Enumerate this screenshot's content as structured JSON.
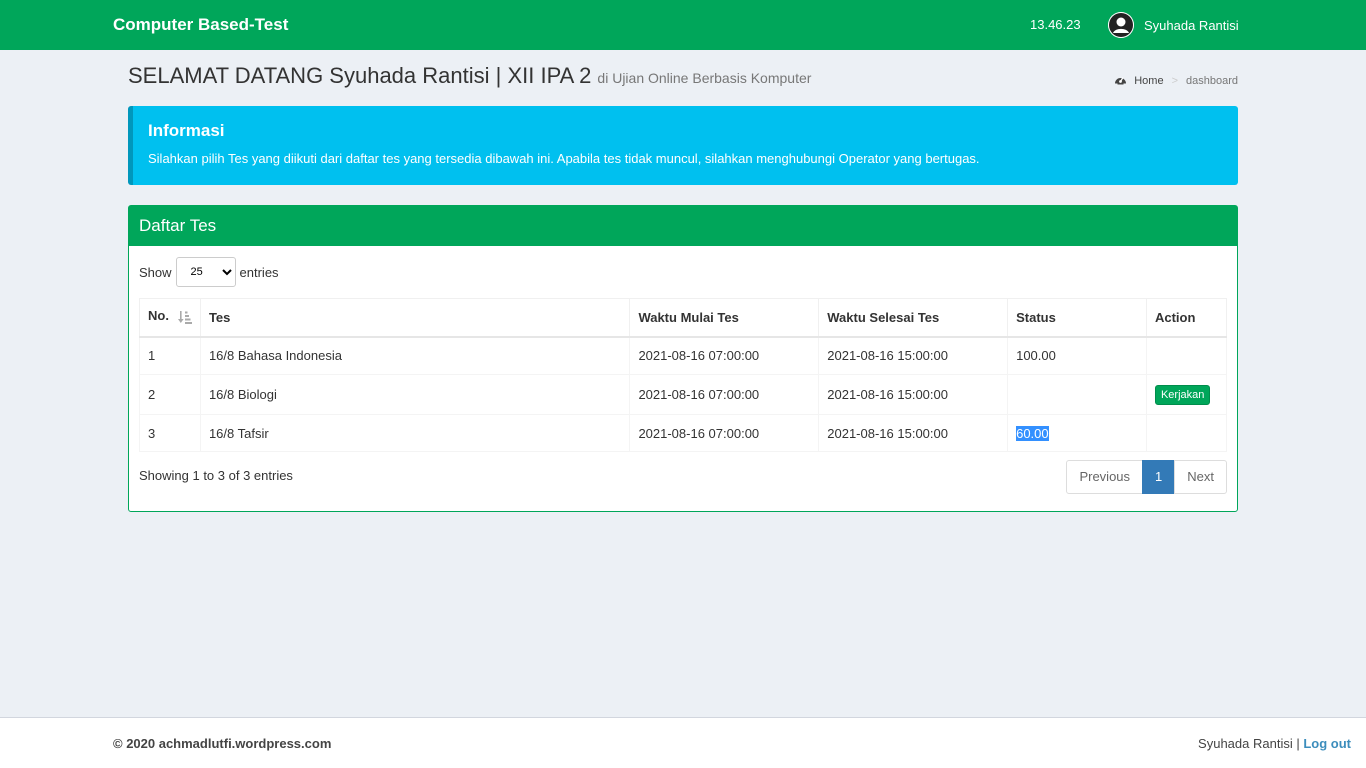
{
  "header": {
    "brand": "Computer Based-Test",
    "time": "13.46.23",
    "user_name": "Syuhada Rantisi"
  },
  "page": {
    "title": "SELAMAT DATANG Syuhada Rantisi | XII IPA 2",
    "subtitle": "di Ujian Online Berbasis Komputer",
    "breadcrumb_home": "Home",
    "breadcrumb_active": "dashboard"
  },
  "callout": {
    "title": "Informasi",
    "text": "Silahkan pilih Tes yang diikuti dari daftar tes yang tersedia dibawah ini. Apabila tes tidak muncul, silahkan menghubungi Operator yang bertugas."
  },
  "box": {
    "title": "Daftar Tes",
    "show_label": "Show",
    "entries_label": "entries",
    "page_length": "25",
    "columns": [
      "No.",
      "Tes",
      "Waktu Mulai Tes",
      "Waktu Selesai Tes",
      "Status",
      "Action"
    ],
    "rows": [
      {
        "no": "1",
        "tes": "16/8 Bahasa Indonesia",
        "mulai": "2021-08-16 07:00:00",
        "selesai": "2021-08-16 15:00:00",
        "status": "100.00",
        "action": ""
      },
      {
        "no": "2",
        "tes": "16/8 Biologi",
        "mulai": "2021-08-16 07:00:00",
        "selesai": "2021-08-16 15:00:00",
        "status": "",
        "action": "Kerjakan"
      },
      {
        "no": "3",
        "tes": "16/8 Tafsir",
        "mulai": "2021-08-16 07:00:00",
        "selesai": "2021-08-16 15:00:00",
        "status": "60.00",
        "action": ""
      }
    ],
    "info": "Showing 1 to 3 of 3 entries",
    "prev_label": "Previous",
    "current_page": "1",
    "next_label": "Next"
  },
  "footer": {
    "copyright": "© 2020 achmadlutfi.wordpress.com",
    "user": "Syuhada Rantisi |",
    "logout": "Log out"
  },
  "colors": {
    "primary_green": "#00a65a",
    "info_cyan": "#00c0ef",
    "page_active_blue": "#337ab7",
    "background": "#ecf0f5"
  },
  "icons": [
    "user-avatar-icon",
    "dashboard-icon",
    "sort-icon"
  ]
}
